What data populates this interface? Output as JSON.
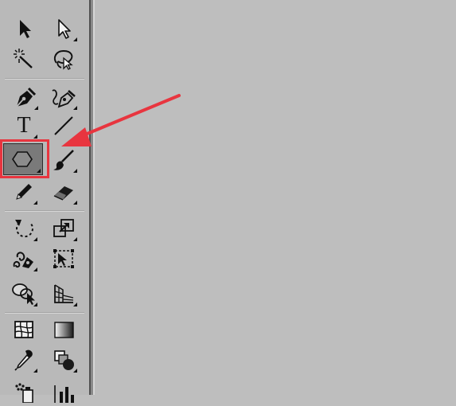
{
  "toolbar": {
    "type_tool_glyph": "T",
    "tools": [
      {
        "name": "selection-tool",
        "icon": "arrow-black-icon"
      },
      {
        "name": "direct-selection-tool",
        "icon": "arrow-white-icon"
      },
      {
        "name": "magic-wand-tool",
        "icon": "magic-wand-icon"
      },
      {
        "name": "lasso-tool",
        "icon": "lasso-icon"
      },
      {
        "name": "pen-tool",
        "icon": "pen-icon"
      },
      {
        "name": "curvature-tool",
        "icon": "curvature-pen-icon"
      },
      {
        "name": "type-tool",
        "icon": "type-icon"
      },
      {
        "name": "line-segment-tool",
        "icon": "line-icon"
      },
      {
        "name": "polygon-tool",
        "icon": "polygon-icon",
        "selected": true
      },
      {
        "name": "paintbrush-tool",
        "icon": "paintbrush-icon"
      },
      {
        "name": "pencil-tool",
        "icon": "pencil-icon"
      },
      {
        "name": "eraser-tool",
        "icon": "eraser-icon"
      },
      {
        "name": "rotate-tool",
        "icon": "rotate-icon"
      },
      {
        "name": "scale-tool",
        "icon": "scale-icon"
      },
      {
        "name": "warp-tool",
        "icon": "warp-icon"
      },
      {
        "name": "free-transform-tool",
        "icon": "free-transform-icon"
      },
      {
        "name": "shape-builder-tool",
        "icon": "shape-builder-icon"
      },
      {
        "name": "perspective-grid-tool",
        "icon": "perspective-grid-icon"
      },
      {
        "name": "mesh-tool",
        "icon": "mesh-icon"
      },
      {
        "name": "gradient-tool",
        "icon": "gradient-icon"
      },
      {
        "name": "eyedropper-tool",
        "icon": "eyedropper-icon"
      },
      {
        "name": "blend-tool",
        "icon": "blend-icon"
      },
      {
        "name": "symbol-sprayer-tool",
        "icon": "symbol-sprayer-icon"
      },
      {
        "name": "column-graph-tool",
        "icon": "column-graph-icon"
      }
    ]
  },
  "annotation": {
    "highlight_color": "#e8353f",
    "arrow_color": "#e8353f"
  },
  "colors": {
    "toolbar_bg": "#b9b9b9",
    "canvas_bg": "#bebebe",
    "selected_tool_bg": "#7a7a7a"
  }
}
